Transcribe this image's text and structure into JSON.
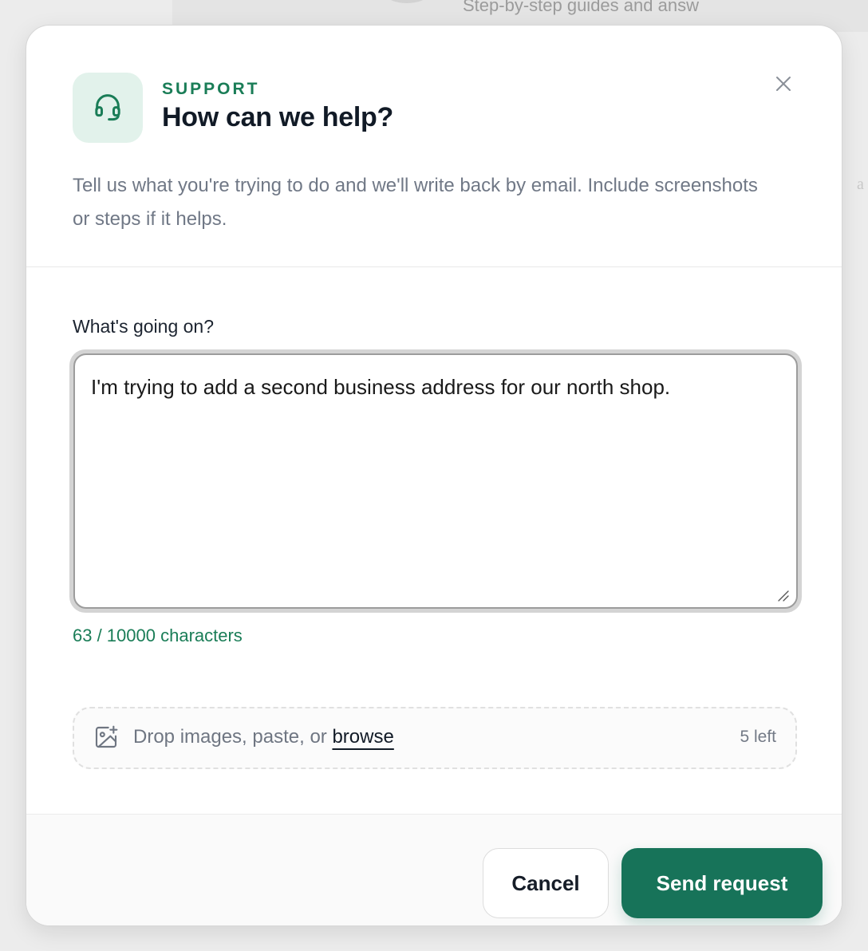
{
  "background": {
    "partial_text": "Step-by-step guides and answ"
  },
  "header": {
    "eyebrow": "SUPPORT",
    "title": "How can we help?",
    "icon": "headset-icon",
    "close_icon": "close-icon"
  },
  "intro": "Tell us what you're trying to do and we'll write back by email. Include screenshots or steps if it helps.",
  "form": {
    "label": "What's going on?",
    "message_value": "I'm trying to add a second business address for our north shop.",
    "char_count": "63 / 10000 characters"
  },
  "attachments": {
    "icon": "image-add-icon",
    "prompt": "Drop images, paste, or",
    "browse_label": "browse",
    "remaining": "5 left"
  },
  "footer": {
    "cancel_label": "Cancel",
    "send_label": "Send request"
  },
  "colors": {
    "accent": "#177359",
    "accent_text": "#1a7d57",
    "icon_bg": "#e2f2eb"
  }
}
